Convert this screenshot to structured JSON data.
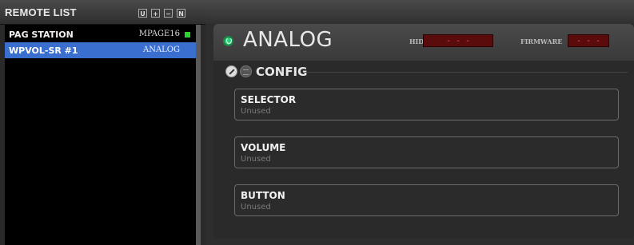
{
  "remote_list": {
    "title": "REMOTE LIST",
    "header_buttons": [
      "U",
      "+",
      "−",
      "N"
    ],
    "items": [
      {
        "name": "PAG STATION",
        "type": "MPAGE16",
        "status_color": "#2ad42a"
      },
      {
        "name": "WPVOL-SR #1",
        "type": "ANALOG"
      }
    ]
  },
  "device": {
    "name": "ANALOG",
    "status_color": "#2fd07a",
    "hid_label": "HID",
    "hid_value": "- - -",
    "firmware_label": "FIRMWARE",
    "firmware_value": "- - -"
  },
  "config": {
    "title": "CONFIG",
    "fields": [
      {
        "label": "SELECTOR",
        "value": "Unused"
      },
      {
        "label": "VOLUME",
        "value": "Unused"
      },
      {
        "label": "BUTTON",
        "value": "Unused"
      }
    ]
  },
  "colors": {
    "selection": "#3a6fcf",
    "readout_bg": "#5a0c0c"
  },
  "icons": [
    "wrench-icon",
    "list-icon",
    "status-led-icon"
  ]
}
